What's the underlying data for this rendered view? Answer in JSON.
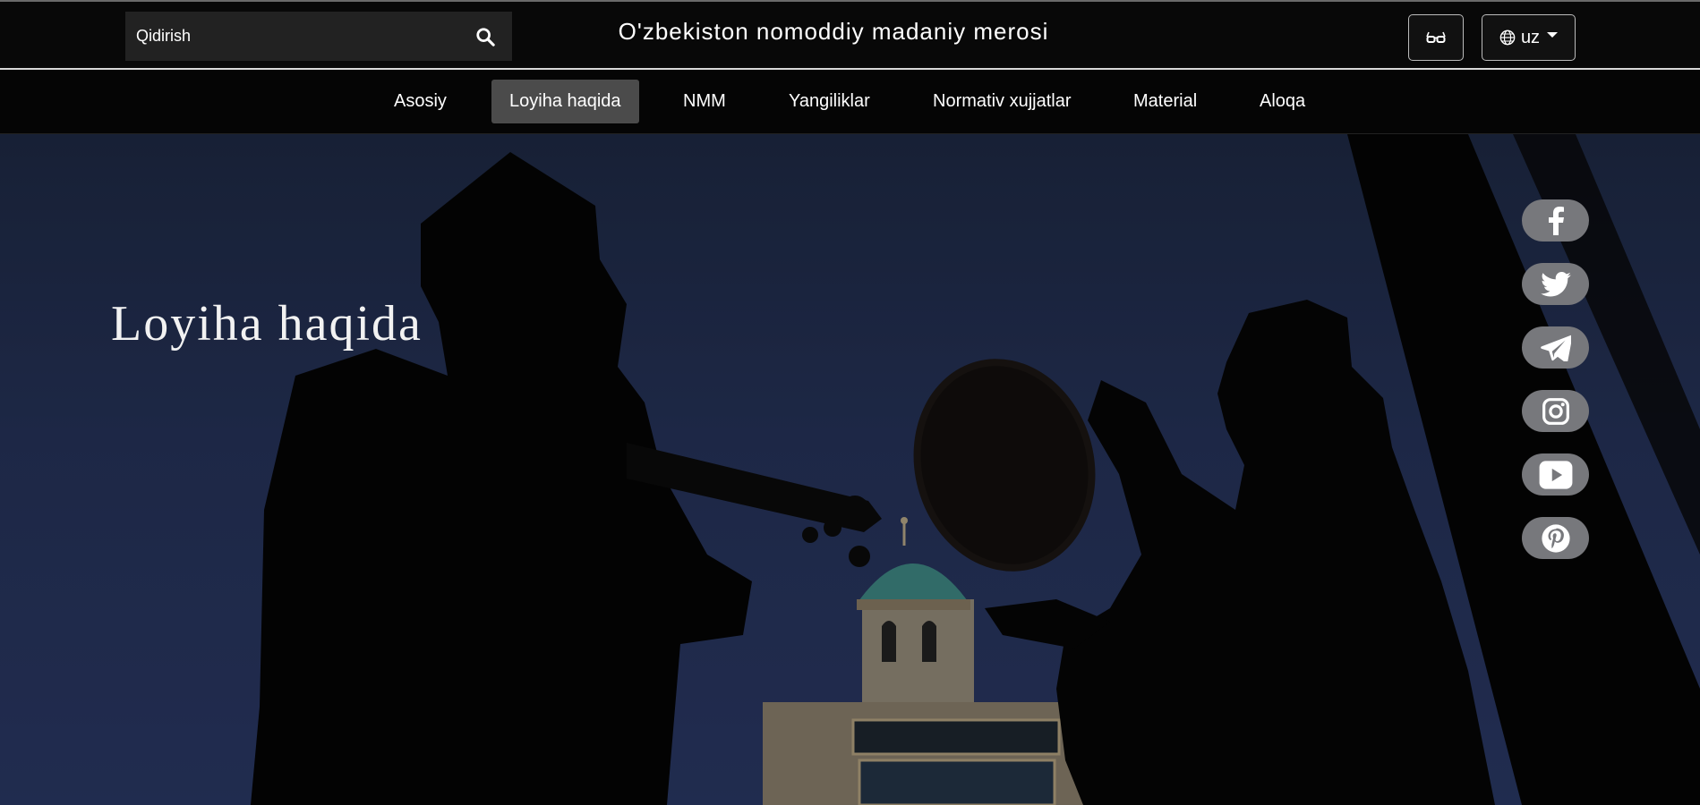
{
  "header": {
    "search_placeholder": "Qidirish",
    "site_title": "O'zbekiston nomoddiy madaniy merosi",
    "language": "uz",
    "icons": {
      "search": "search-icon",
      "accessibility": "glasses-icon",
      "globe": "globe-icon",
      "caret": "caret-down-icon"
    }
  },
  "nav": {
    "items": [
      {
        "label": "Asosiy",
        "active": false
      },
      {
        "label": "Loyiha haqida",
        "active": true
      },
      {
        "label": "NMM",
        "active": false
      },
      {
        "label": "Yangiliklar",
        "active": false
      },
      {
        "label": "Normativ xujjatlar",
        "active": false
      },
      {
        "label": "Material",
        "active": false
      },
      {
        "label": "Aloqa",
        "active": false
      }
    ]
  },
  "hero": {
    "title": "Loyiha haqida"
  },
  "social": [
    "facebook-icon",
    "twitter-icon",
    "telegram-icon",
    "instagram-icon",
    "youtube-icon",
    "pinterest-icon"
  ],
  "colors": {
    "header_bg": "#080808",
    "active_nav_bg": "#4b4b4b",
    "social_bg": "#77787c",
    "sky": "#26335a"
  }
}
